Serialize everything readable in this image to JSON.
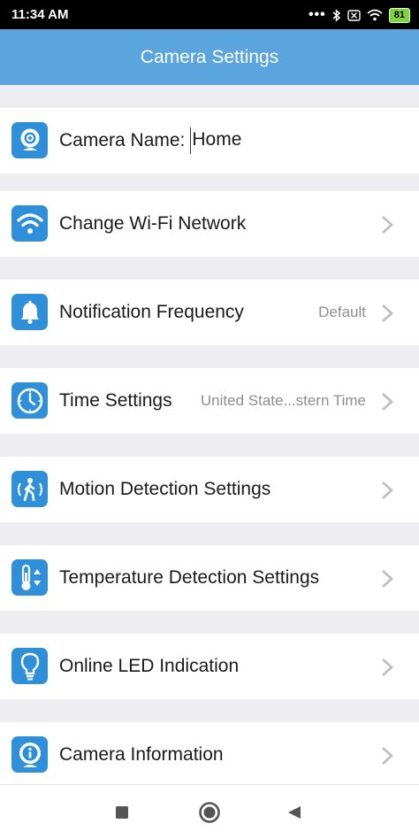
{
  "status_bar": {
    "time": "11:34 AM",
    "battery": "81",
    "icons": [
      "more-dots-icon",
      "bluetooth-icon",
      "sim-off-icon",
      "wifi-icon",
      "battery-icon"
    ]
  },
  "app_bar": {
    "title": "Camera Settings"
  },
  "settings": {
    "camera_name": {
      "label": "Camera Name:",
      "value": "Home",
      "icon": "camera-icon"
    },
    "wifi": {
      "label": "Change Wi-Fi Network",
      "icon": "wifi-icon"
    },
    "notification": {
      "label": "Notification Frequency",
      "value": "Default",
      "icon": "bell-icon"
    },
    "time": {
      "label": "Time Settings",
      "value": "United State...stern Time",
      "icon": "clock-icon"
    },
    "motion": {
      "label": "Motion Detection Settings",
      "icon": "walking-person-icon"
    },
    "temperature": {
      "label": "Temperature Detection Settings",
      "icon": "thermometer-icon"
    },
    "led": {
      "label": "Online LED Indication",
      "icon": "lightbulb-icon"
    },
    "info": {
      "label": "Camera Information",
      "icon": "info-icon"
    }
  },
  "nav_bar": {
    "buttons": [
      "recents-square-icon",
      "home-circle-icon",
      "back-triangle-icon"
    ]
  },
  "colors": {
    "accent": "#5aa5de",
    "icon_bg": "#2f8fd8",
    "background": "#ededf2"
  }
}
